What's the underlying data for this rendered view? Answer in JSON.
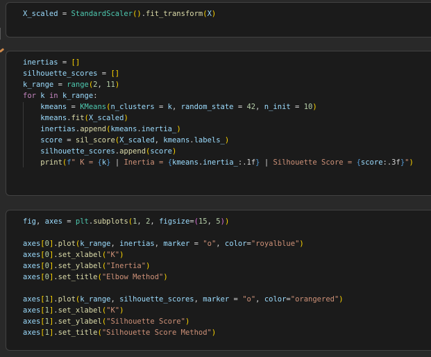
{
  "editor": {
    "outer_background": "#292929",
    "cell_background": "#1b1b1b",
    "cell_border": "#424242",
    "indent_guide_color": "#3a3a3a",
    "left_edge_mark_color": "#cf8a4b"
  },
  "token_colors": {
    "var": "#9cdcfe",
    "op": "#d4d4d4",
    "plain": "#d4d4d4",
    "cls": "#4ec9b0",
    "func": "#dcdcaa",
    "num": "#b5cea8",
    "str": "#ce9178",
    "kw": "#c586c0",
    "fstr": "#569cd6",
    "b1": "#ffd700",
    "b2": "#da70d6"
  },
  "cells": [
    {
      "language": "python",
      "lines": [
        [
          [
            "var",
            "X_scaled"
          ],
          [
            "op",
            " = "
          ],
          [
            "cls",
            "StandardScaler"
          ],
          [
            "b1",
            "()"
          ],
          [
            "op",
            "."
          ],
          [
            "func",
            "fit_transform"
          ],
          [
            "b1",
            "("
          ],
          [
            "var",
            "X"
          ],
          [
            "b1",
            ")"
          ]
        ]
      ]
    },
    {
      "language": "python",
      "lines": [
        [
          [
            "var",
            "inertias"
          ],
          [
            "op",
            " = "
          ],
          [
            "b1",
            "[]"
          ]
        ],
        [
          [
            "var",
            "silhouette_scores"
          ],
          [
            "op",
            " = "
          ],
          [
            "b1",
            "[]"
          ]
        ],
        [
          [
            "var",
            "k_range"
          ],
          [
            "op",
            " = "
          ],
          [
            "cls",
            "range"
          ],
          [
            "b1",
            "("
          ],
          [
            "num",
            "2"
          ],
          [
            "op",
            ", "
          ],
          [
            "num",
            "11"
          ],
          [
            "b1",
            ")"
          ]
        ],
        [
          [
            "kw",
            "for"
          ],
          [
            "op",
            " "
          ],
          [
            "var",
            "k"
          ],
          [
            "op",
            " "
          ],
          [
            "kw",
            "in"
          ],
          [
            "op",
            " "
          ],
          [
            "var",
            "k_range"
          ],
          [
            "op",
            ":"
          ]
        ],
        [
          [
            "plain",
            "    "
          ],
          [
            "var",
            "kmeans"
          ],
          [
            "op",
            " = "
          ],
          [
            "cls",
            "KMeans"
          ],
          [
            "b1",
            "("
          ],
          [
            "var",
            "n_clusters"
          ],
          [
            "op",
            " = "
          ],
          [
            "var",
            "k"
          ],
          [
            "op",
            ", "
          ],
          [
            "var",
            "random_state"
          ],
          [
            "op",
            " = "
          ],
          [
            "num",
            "42"
          ],
          [
            "op",
            ", "
          ],
          [
            "var",
            "n_init"
          ],
          [
            "op",
            " = "
          ],
          [
            "num",
            "10"
          ],
          [
            "b1",
            ")"
          ]
        ],
        [
          [
            "plain",
            "    "
          ],
          [
            "var",
            "kmeans"
          ],
          [
            "op",
            "."
          ],
          [
            "func",
            "fit"
          ],
          [
            "b1",
            "("
          ],
          [
            "var",
            "X_scaled"
          ],
          [
            "b1",
            ")"
          ]
        ],
        [
          [
            "plain",
            "    "
          ],
          [
            "var",
            "inertias"
          ],
          [
            "op",
            "."
          ],
          [
            "func",
            "append"
          ],
          [
            "b1",
            "("
          ],
          [
            "var",
            "kmeans"
          ],
          [
            "op",
            "."
          ],
          [
            "var",
            "inertia_"
          ],
          [
            "b1",
            ")"
          ]
        ],
        [
          [
            "plain",
            "    "
          ],
          [
            "var",
            "score"
          ],
          [
            "op",
            " = "
          ],
          [
            "func",
            "sil_score"
          ],
          [
            "b1",
            "("
          ],
          [
            "var",
            "X_scaled"
          ],
          [
            "op",
            ", "
          ],
          [
            "var",
            "kmeans"
          ],
          [
            "op",
            "."
          ],
          [
            "var",
            "labels_"
          ],
          [
            "b1",
            ")"
          ]
        ],
        [
          [
            "plain",
            "    "
          ],
          [
            "var",
            "silhouette_scores"
          ],
          [
            "op",
            "."
          ],
          [
            "func",
            "append"
          ],
          [
            "b1",
            "("
          ],
          [
            "var",
            "score"
          ],
          [
            "b1",
            ")"
          ]
        ],
        [
          [
            "plain",
            "    "
          ],
          [
            "func",
            "print"
          ],
          [
            "b1",
            "("
          ],
          [
            "fstr",
            "f"
          ],
          [
            "str",
            "\" K = "
          ],
          [
            "fstr",
            "{"
          ],
          [
            "var",
            "k"
          ],
          [
            "fstr",
            "}"
          ],
          [
            "str",
            " "
          ],
          [
            "op",
            "|"
          ],
          [
            "str",
            " Inertia = "
          ],
          [
            "fstr",
            "{"
          ],
          [
            "var",
            "kmeans"
          ],
          [
            "op",
            "."
          ],
          [
            "var",
            "inertia_"
          ],
          [
            "op",
            ":"
          ],
          [
            "plain",
            ".1f"
          ],
          [
            "fstr",
            "}"
          ],
          [
            "str",
            " "
          ],
          [
            "op",
            "|"
          ],
          [
            "str",
            " Silhouette Score = "
          ],
          [
            "fstr",
            "{"
          ],
          [
            "var",
            "score"
          ],
          [
            "op",
            ":"
          ],
          [
            "plain",
            ".3f"
          ],
          [
            "fstr",
            "}"
          ],
          [
            "str",
            "\""
          ],
          [
            "b1",
            ")"
          ]
        ]
      ]
    },
    {
      "language": "python",
      "lines": [
        [
          [
            "var",
            "fig"
          ],
          [
            "op",
            ", "
          ],
          [
            "var",
            "axes"
          ],
          [
            "op",
            " = "
          ],
          [
            "cls",
            "plt"
          ],
          [
            "op",
            "."
          ],
          [
            "func",
            "subplots"
          ],
          [
            "b1",
            "("
          ],
          [
            "num",
            "1"
          ],
          [
            "op",
            ", "
          ],
          [
            "num",
            "2"
          ],
          [
            "op",
            ", "
          ],
          [
            "var",
            "figsize"
          ],
          [
            "op",
            "="
          ],
          [
            "b2",
            "("
          ],
          [
            "num",
            "15"
          ],
          [
            "op",
            ", "
          ],
          [
            "num",
            "5"
          ],
          [
            "b2",
            ")"
          ],
          [
            "b1",
            ")"
          ]
        ],
        [],
        [
          [
            "var",
            "axes"
          ],
          [
            "b1",
            "["
          ],
          [
            "num",
            "0"
          ],
          [
            "b1",
            "]"
          ],
          [
            "op",
            "."
          ],
          [
            "func",
            "plot"
          ],
          [
            "b1",
            "("
          ],
          [
            "var",
            "k_range"
          ],
          [
            "op",
            ", "
          ],
          [
            "var",
            "inertias"
          ],
          [
            "op",
            ", "
          ],
          [
            "var",
            "marker"
          ],
          [
            "op",
            " = "
          ],
          [
            "str",
            "\"o\""
          ],
          [
            "op",
            ", "
          ],
          [
            "var",
            "color"
          ],
          [
            "op",
            "="
          ],
          [
            "str",
            "\"royalblue\""
          ],
          [
            "b1",
            ")"
          ]
        ],
        [
          [
            "var",
            "axes"
          ],
          [
            "b1",
            "["
          ],
          [
            "num",
            "0"
          ],
          [
            "b1",
            "]"
          ],
          [
            "op",
            "."
          ],
          [
            "func",
            "set_xlabel"
          ],
          [
            "b1",
            "("
          ],
          [
            "str",
            "\"K\""
          ],
          [
            "b1",
            ")"
          ]
        ],
        [
          [
            "var",
            "axes"
          ],
          [
            "b1",
            "["
          ],
          [
            "num",
            "0"
          ],
          [
            "b1",
            "]"
          ],
          [
            "op",
            "."
          ],
          [
            "func",
            "set_ylabel"
          ],
          [
            "b1",
            "("
          ],
          [
            "str",
            "\"Inertia\""
          ],
          [
            "b1",
            ")"
          ]
        ],
        [
          [
            "var",
            "axes"
          ],
          [
            "b1",
            "["
          ],
          [
            "num",
            "0"
          ],
          [
            "b1",
            "]"
          ],
          [
            "op",
            "."
          ],
          [
            "func",
            "set_title"
          ],
          [
            "b1",
            "("
          ],
          [
            "str",
            "\"Elbow Method\""
          ],
          [
            "b1",
            ")"
          ]
        ],
        [],
        [
          [
            "var",
            "axes"
          ],
          [
            "b1",
            "["
          ],
          [
            "num",
            "1"
          ],
          [
            "b1",
            "]"
          ],
          [
            "op",
            "."
          ],
          [
            "func",
            "plot"
          ],
          [
            "b1",
            "("
          ],
          [
            "var",
            "k_range"
          ],
          [
            "op",
            ", "
          ],
          [
            "var",
            "silhouette_scores"
          ],
          [
            "op",
            ", "
          ],
          [
            "var",
            "marker"
          ],
          [
            "op",
            " = "
          ],
          [
            "str",
            "\"o\""
          ],
          [
            "op",
            ", "
          ],
          [
            "var",
            "color"
          ],
          [
            "op",
            "="
          ],
          [
            "str",
            "\"orangered\""
          ],
          [
            "b1",
            ")"
          ]
        ],
        [
          [
            "var",
            "axes"
          ],
          [
            "b1",
            "["
          ],
          [
            "num",
            "1"
          ],
          [
            "b1",
            "]"
          ],
          [
            "op",
            "."
          ],
          [
            "func",
            "set_xlabel"
          ],
          [
            "b1",
            "("
          ],
          [
            "str",
            "\"K\""
          ],
          [
            "b1",
            ")"
          ]
        ],
        [
          [
            "var",
            "axes"
          ],
          [
            "b1",
            "["
          ],
          [
            "num",
            "1"
          ],
          [
            "b1",
            "]"
          ],
          [
            "op",
            "."
          ],
          [
            "func",
            "set_ylabel"
          ],
          [
            "b1",
            "("
          ],
          [
            "str",
            "\"Silhouette Score\""
          ],
          [
            "b1",
            ")"
          ]
        ],
        [
          [
            "var",
            "axes"
          ],
          [
            "b1",
            "["
          ],
          [
            "num",
            "1"
          ],
          [
            "b1",
            "]"
          ],
          [
            "op",
            "."
          ],
          [
            "func",
            "set_title"
          ],
          [
            "b1",
            "("
          ],
          [
            "str",
            "\"Silhouette Score Method\""
          ],
          [
            "b1",
            ")"
          ]
        ]
      ]
    }
  ]
}
